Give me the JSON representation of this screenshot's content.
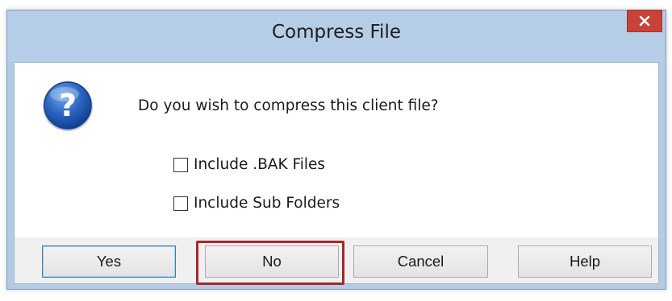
{
  "dialog": {
    "title": "Compress File",
    "message": "Do you wish to compress this client file?",
    "icon": "question-icon"
  },
  "options": [
    {
      "label": "Include .BAK Files",
      "checked": false
    },
    {
      "label": "Include Sub Folders",
      "checked": false
    }
  ],
  "buttons": {
    "yes": "Yes",
    "no": "No",
    "cancel": "Cancel",
    "help": "Help"
  },
  "colors": {
    "titlebar": "#b5cde6",
    "close_button": "#c7423a",
    "highlight": "#a8262a",
    "button_face": "#e8e8e8"
  }
}
